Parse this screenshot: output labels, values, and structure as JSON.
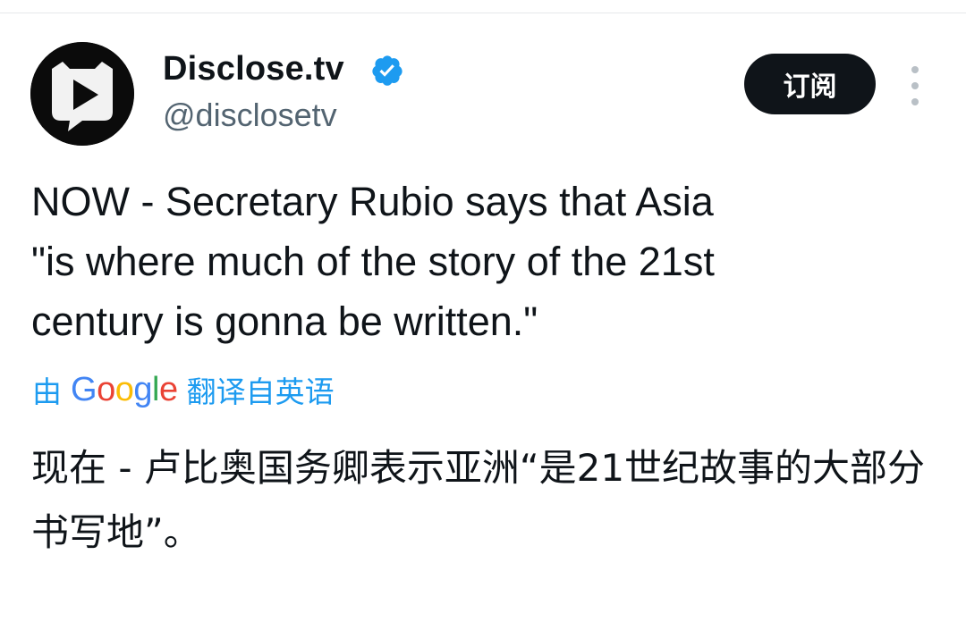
{
  "tweet": {
    "display_name": "Disclose.tv",
    "handle": "@disclosetv",
    "verified_icon": "verified-badge-icon",
    "subscribe_label": "订阅",
    "more_icon": "more-vertical-icon",
    "text": "NOW - Secretary Rubio says that Asia\n\"is where much of the story of the 21st\ncentury is gonna be written.\"",
    "translation": {
      "prefix": "由",
      "provider": "Google",
      "suffix": "翻译自英语",
      "text": "现在 - 卢比奥国务卿表示亚洲“是21世纪故事的大部分书写地”。"
    }
  },
  "colors": {
    "text": "#0f1419",
    "secondary": "#536471",
    "link": "#1d9bf0",
    "verified": "#1d9bf0",
    "button_bg": "#0f1419"
  }
}
